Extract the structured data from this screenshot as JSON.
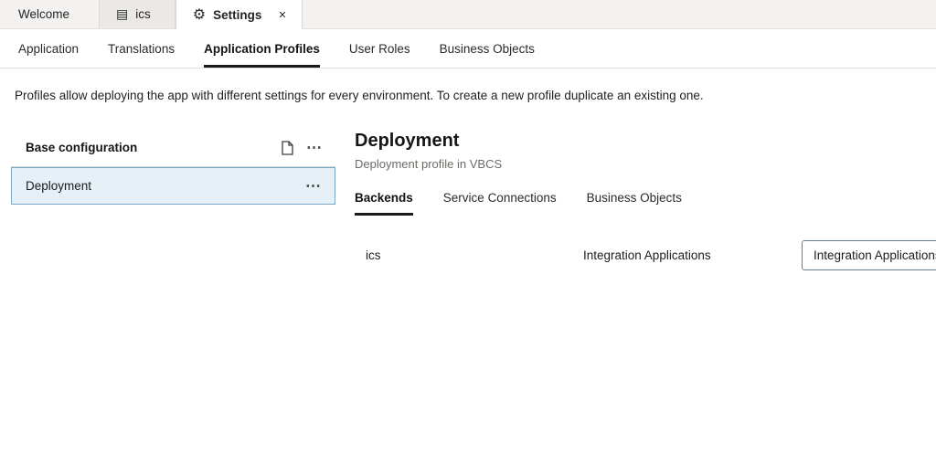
{
  "icons": {
    "app": "▤",
    "gear": "⚙",
    "close": "✕",
    "ellipsis": "⋯"
  },
  "colors": {
    "selected_row_bg": "#e6f0f7",
    "selected_row_border": "#7ba7c9",
    "active_underline": "#1a1a1a"
  },
  "window_tabs": {
    "tabs": [
      {
        "label": "Welcome"
      },
      {
        "label": "ics"
      },
      {
        "label": "Settings"
      }
    ]
  },
  "subnav": {
    "tabs": [
      {
        "label": "Application"
      },
      {
        "label": "Translations"
      },
      {
        "label": "Application Profiles"
      },
      {
        "label": "User Roles"
      },
      {
        "label": "Business Objects"
      }
    ]
  },
  "description": "Profiles allow deploying the app with different settings for every environment. To create a new profile duplicate an existing one.",
  "profiles": {
    "header_label": "Base configuration",
    "items": [
      {
        "label": "Deployment"
      }
    ]
  },
  "detail": {
    "title": "Deployment",
    "subtitle": "Deployment profile in VBCS",
    "tabs": [
      {
        "label": "Backends"
      },
      {
        "label": "Service Connections"
      },
      {
        "label": "Business Objects"
      }
    ],
    "backends": [
      {
        "name": "ics",
        "type": "Integration Applications",
        "selected_value": "Integration Applications"
      }
    ]
  }
}
